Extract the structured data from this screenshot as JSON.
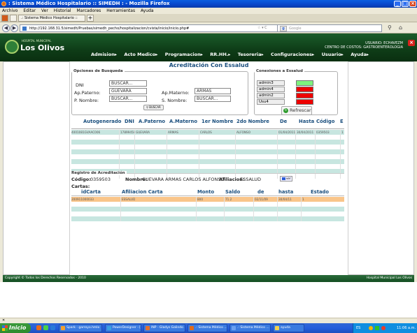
{
  "window": {
    "title": ": Sistema Médico Hospitalario :: SIMEDH : - Mozilla Firefox",
    "min": "_",
    "max": "□",
    "close": "×"
  },
  "menubar": [
    "Archivo",
    "Editar",
    "Ver",
    "Historial",
    "Marcadores",
    "Herramientas",
    "Ayuda"
  ],
  "tabs": [
    {
      "label": ".: Sistema Médico Hospitalario :: SIMEDH :..."
    }
  ],
  "newtab": "+",
  "nav": {
    "back": "◀",
    "forward": "▶",
    "url": "http://192.168.31.5/simedh/Pruebas/simedh_pecho/hospitalizacion/cvista/inicio/inicio.php#",
    "search_placeholder": "Google",
    "url_end": "☆ ▾ C",
    "home": "⌂",
    "mag": "⚲"
  },
  "app": {
    "logo_sub": "HOSPITAL MUNICIPAL",
    "logo_main": "Los Olivos",
    "menu": [
      "Admision▸",
      "Acto Medico▸",
      "Programacion▸",
      "RR.HH.▸",
      "Tesoreria▸",
      "Configuraciones▸",
      "Usuario▸",
      "Ayuda▸"
    ],
    "user": "USUARIO: ECHAVEZM",
    "center": "CENTRO DE COSTOS: GASTROENTEROLOGIA",
    "close": "×"
  },
  "page_title": "Acreditación Con Essalud",
  "search": {
    "legend": "Opciones de Busqueda",
    "dni_label": "DNI",
    "dni_value": "BUSCAR...",
    "ap_paterno_label": "Ap.Paterno:",
    "ap_paterno_value": "GUEVARA",
    "ap_materno_label": "Ap.Materno:",
    "ap_materno_value": "ARMAS",
    "p_nombre_label": "P. Nombre:",
    "p_nombre_value": "BUSCAR...",
    "s_nombre_label": "S. Nombre:",
    "s_nombre_value": "BUSCAR...",
    "buscar_btn": "BUSCAR"
  },
  "connections": {
    "legend": "Conexiones a Essalud",
    "items": [
      {
        "name": "admin3",
        "status": "ok",
        "color": "#7ef27e"
      },
      {
        "name": "admin4",
        "status": "fail",
        "color": "#ee0000"
      },
      {
        "name": "admin2",
        "status": "fail",
        "color": "#ee0000"
      },
      {
        "name": "Usu4",
        "status": "fail",
        "color": "#ee0000"
      }
    ],
    "refresh_label": "Refrescar"
  },
  "grid": {
    "headers": [
      "Autogenerado",
      "DNI",
      "A.Paterno",
      "A.Materno",
      "1er Nombre",
      "2do Nombre",
      "De",
      "Hasta",
      "Código",
      "E"
    ],
    "rows": [
      [
        "4001081GVAAC006",
        "17899458",
        "GUEVARA",
        "ARMAS",
        "CARLOS",
        "ALFONSO",
        "01/04/2011",
        "30/04/2011",
        "0359503",
        "1"
      ]
    ],
    "row_colors": [
      "#c7e6e0",
      "#ffffff",
      "#c7e6e0",
      "#ffffff",
      "#c7e6e0",
      "#ffffff",
      "#c7e6e0",
      "#ffffff",
      "#c7e6e0",
      "#ffffff"
    ]
  },
  "acred": {
    "legend": "Registro de Acreditación",
    "codigo_label": "Código:",
    "codigo_value": "0359503",
    "nombre_label": "Nombre:",
    "nombre_value": "GUEVARA ARMAS CARLOS ALFONSO",
    "afiliacion_label": "Afiliacion:",
    "afiliacion_value": "ESSALUD",
    "badge": "ver",
    "cartas_label": "Cartas:",
    "headers": [
      "idCarta",
      "Afiliacion Carta",
      "Monto",
      "Saldo",
      "de",
      "hasta",
      "Estado"
    ],
    "rows": [
      [
        "200911000033",
        "ESSALUD",
        "800",
        "71.2",
        "02/11/09",
        "30/04/11",
        "1"
      ]
    ],
    "row_colors": [
      "#f9c58a",
      "#ffffff",
      "#c7e6e0",
      "#ffffff",
      "#c7e6e0"
    ]
  },
  "footer": {
    "left": "Copyright © Todos los Derechos Reservados - 2010",
    "right": "Hospital Municipal Los Olivos"
  },
  "statusbar": "✕",
  "taskbar": {
    "start": "Inicio",
    "tasks": [
      {
        "label": "Spark - garroyo.hmlo",
        "color": "#f0a030"
      },
      {
        "label": "PowerDesigner - [...",
        "color": "#3aa0e0"
      },
      {
        "label": "INP - Gladys Galindo ...",
        "color": "#e07030"
      },
      {
        "label": ".: Sistema Médico ...",
        "color": "#e06a1a"
      },
      {
        "label": ".: Sistema Médico ...",
        "color": "#6aa0f0"
      },
      {
        "label": "ayuda",
        "color": "#f0d050"
      }
    ],
    "lang": "ES",
    "clock": "11:06 a.m."
  }
}
